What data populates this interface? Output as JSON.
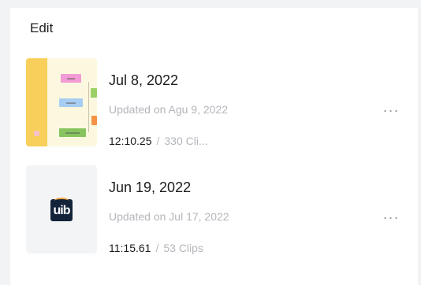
{
  "panel": {
    "title": "Edit"
  },
  "projects": [
    {
      "date": "Jul 8, 2022",
      "updated": "Updated on Agu 9, 2022",
      "duration": "12:10.25",
      "separator": "/",
      "clips": "330 Cli...",
      "more_icon": "more-horizontal-icon",
      "more_glyph": "···"
    },
    {
      "date": "Jun 19, 2022",
      "updated": "Updated on Jul 17, 2022",
      "duration": "11:15.61",
      "separator": "/",
      "clips": "53 Clips",
      "logo_text": "uib",
      "more_icon": "more-horizontal-icon",
      "more_glyph": "···"
    }
  ],
  "colors": {
    "background": "#f2f3f5",
    "panel": "#ffffff",
    "primary_text": "#1b1b1b",
    "secondary_text": "#b3b6bb"
  }
}
